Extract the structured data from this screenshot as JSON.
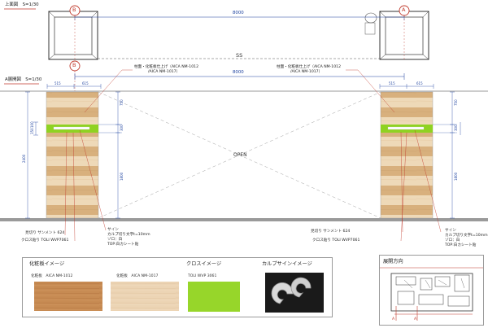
{
  "plan": {
    "title": "上面図　S=1/30",
    "marker_b": "B",
    "marker_a": "A",
    "dim_total": "8000",
    "label_ss": "SS"
  },
  "elevation": {
    "title": "A展開図　S=1/30",
    "marker_b": "B",
    "dim_total": "8000",
    "top_left_dims": [
      "515",
      "615"
    ],
    "top_right_dims": [
      "515",
      "615"
    ],
    "side_dims": [
      "750",
      "300",
      "1800"
    ],
    "height_dim": "2400",
    "small_dims": [
      "150",
      "100"
    ],
    "open_label": "OPEN",
    "note_top_left": [
      "柱面・化粧板仕上げ（AICA NM-1012",
      "/AICA NM-1017）"
    ],
    "note_top_right": [
      "柱面・化粧板仕上げ（AICA NM-1012",
      "/AICA NM-1017）"
    ],
    "left_notes": [
      "見切り サンメント 624",
      "クロス貼り TOLI WVP7061"
    ],
    "right_notes": [
      "見切り サンメント 624",
      "クロス貼り TOLI WVP7061"
    ],
    "sign_note_left": [
      "サイン",
      "カルプ切り文字t=10mm",
      "ゾロ：白",
      "TOP:白カシート貼"
    ],
    "sign_note_right": [
      "サイン",
      "カルプ切り文字t=10mm",
      "ゾロ：白",
      "TOP:白カシート貼"
    ]
  },
  "samples": {
    "veneer_title": "化粧板イメージ",
    "veneer_1": "化粧板　AICA NM-1012",
    "veneer_2": "化粧板　AICA NM-1017",
    "cloth_title": "クロスイメージ",
    "cloth_1": "TOLI WVP 3061",
    "sign_title": "カルプサインイメージ"
  },
  "minimap": {
    "title": "展開方向",
    "marker_a1": "A",
    "marker_a2": "A'"
  },
  "colors": {
    "accent_red": "#c0392b",
    "dim_blue": "#1a3f9e",
    "wood_light": "#ecd7b6",
    "wood_dark": "#d5ad7a",
    "green": "#8fd222",
    "floor": "#9a9a9a"
  }
}
